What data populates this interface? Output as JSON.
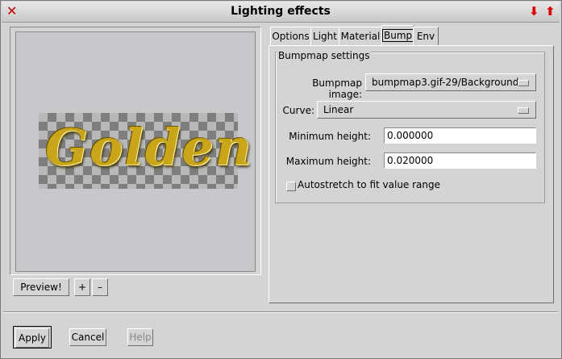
{
  "window": {
    "title": "Lighting effects",
    "close_icon": "close-x-icon",
    "minimize_icon": "arrow-down-icon",
    "maximize_icon": "arrow-up-icon"
  },
  "preview": {
    "image_text": "Golden",
    "preview_button": "Preview!",
    "zoom_in": "+",
    "zoom_out": "–"
  },
  "tabs": [
    {
      "label": "Options",
      "active": false
    },
    {
      "label": "Light",
      "active": false
    },
    {
      "label": "Material",
      "active": false
    },
    {
      "label": "Bump",
      "active": true
    },
    {
      "label": "Env",
      "active": false
    }
  ],
  "bump": {
    "group_title": "Bumpmap settings",
    "bumpmap_image_label": "Bumpmap image:",
    "bumpmap_image_value": "bumpmap3.gif-29/Background",
    "curve_label": "Curve:",
    "curve_value": "Linear",
    "min_height_label": "Minimum height:",
    "min_height_value": "0.000000",
    "max_height_label": "Maximum height:",
    "max_height_value": "0.020000",
    "autostretch_label": "Autostretch to fit value range",
    "autostretch_checked": false
  },
  "actions": {
    "apply": "Apply",
    "cancel": "Cancel",
    "help": "Help"
  },
  "colors": {
    "background": "#d4d4d4",
    "title_icons": "#e00000",
    "help_disabled_text": "#8a8a8a"
  }
}
